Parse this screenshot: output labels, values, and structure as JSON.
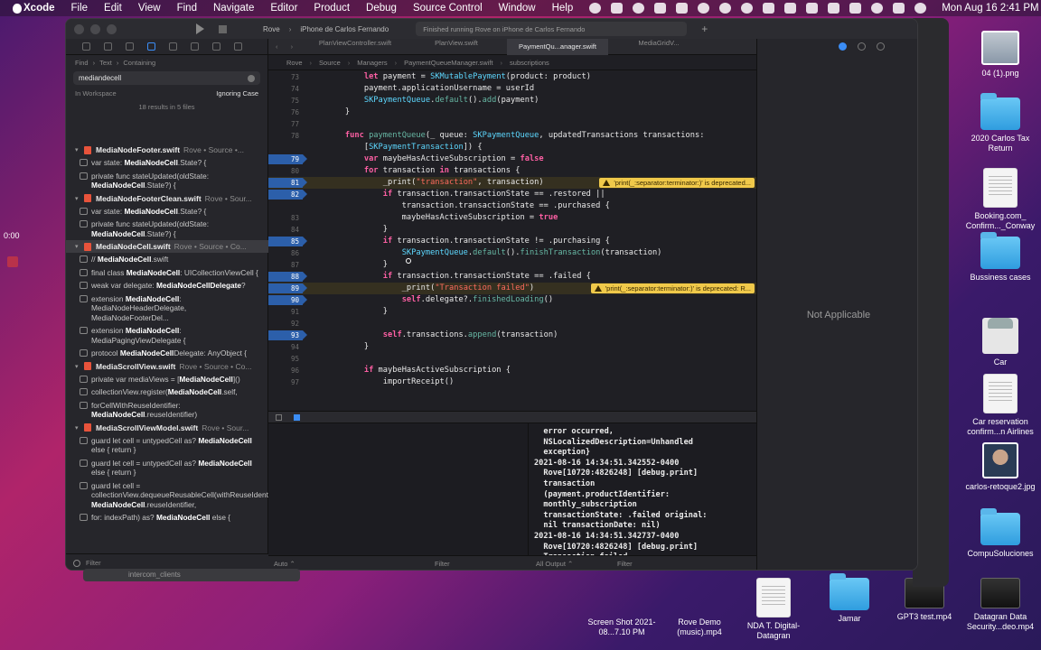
{
  "menubar": {
    "items": [
      "Xcode",
      "File",
      "Edit",
      "View",
      "Find",
      "Navigate",
      "Editor",
      "Product",
      "Debug",
      "Source Control",
      "Window",
      "Help"
    ],
    "clock": "Mon Aug 16  2:41 PM"
  },
  "desktop": {
    "icons": [
      {
        "label": "04 (1).png",
        "kind": "photo"
      },
      {
        "label": "2020 Carlos Tax Return",
        "kind": "folder"
      },
      {
        "label": "Booking.com_ Confirm..._Conway",
        "kind": "doc"
      },
      {
        "label": "Bussiness cases",
        "kind": "folder"
      },
      {
        "label": "Car",
        "kind": "car"
      },
      {
        "label": "Car reservation confirm...n Airlines",
        "kind": "doc"
      },
      {
        "label": "carlos-retoque2.jpg",
        "kind": "person"
      },
      {
        "label": "CompuSoluciones",
        "kind": "folder"
      },
      {
        "label": "Screen Shot 2021-08...7.10 PM",
        "kind": "none"
      },
      {
        "label": "Rove Demo (music).mp4",
        "kind": "none"
      },
      {
        "label": "NDA T. Digital-Datagran",
        "kind": "doc"
      },
      {
        "label": "Jamar",
        "kind": "folder"
      },
      {
        "label": "GPT3 test.mp4",
        "kind": "dark"
      },
      {
        "label": "Datagran Data Security...deo.mp4",
        "kind": "dark"
      }
    ]
  },
  "toolbar": {
    "scheme": "Rove",
    "destination": "iPhone de Carlos Fernando",
    "activity": "Finished running Rove on iPhone de Carlos Fernando"
  },
  "navigator": {
    "find_path": [
      "Find",
      "Text",
      "Containing"
    ],
    "search_query": "mediandecell",
    "scope": "In Workspace",
    "case_mode": "Ignoring Case",
    "results_count": "18 results in 5 files",
    "filter_placeholder": "Filter",
    "results": [
      {
        "type": "file",
        "name": "MediaNodeFooter.swift",
        "path": "Rove • Source •...",
        "selected": false
      },
      {
        "type": "match",
        "pre": "var state: ",
        "hit": "MediaNodeCell",
        "post": ".State? {"
      },
      {
        "type": "match",
        "pre": "private func stateUpdated(oldState: ",
        "hit": "MediaNodeCell",
        "post": ".State?) {"
      },
      {
        "type": "file",
        "name": "MediaNodeFooterClean.swift",
        "path": "Rove • Sour...",
        "selected": false
      },
      {
        "type": "match",
        "pre": "var state: ",
        "hit": "MediaNodeCell",
        "post": ".State? {"
      },
      {
        "type": "match",
        "pre": "private func stateUpdated(oldState: ",
        "hit": "MediaNodeCell",
        "post": ".State?) {"
      },
      {
        "type": "file",
        "name": "MediaNodeCell.swift",
        "path": "Rove • Source • Co...",
        "selected": true
      },
      {
        "type": "match",
        "pre": "// ",
        "hit": "MediaNodeCell",
        "post": ".swift"
      },
      {
        "type": "match",
        "pre": "final class ",
        "hit": "MediaNodeCell",
        "post": ": UICollectionViewCell {"
      },
      {
        "type": "match",
        "pre": "weak var delegate: ",
        "hit": "MediaNodeCellDelegate",
        "post": "?"
      },
      {
        "type": "match",
        "pre": "extension ",
        "hit": "MediaNodeCell",
        "post": ": MediaNodeHeaderDelegate, MediaNodeFooterDel..."
      },
      {
        "type": "match",
        "pre": "extension ",
        "hit": "MediaNodeCell",
        "post": ": MediaPagingViewDelegate {"
      },
      {
        "type": "match",
        "pre": "protocol ",
        "hit": "MediaNodeCell",
        "post": "Delegate: AnyObject {"
      },
      {
        "type": "file",
        "name": "MediaScrollView.swift",
        "path": "Rove • Source • Co...",
        "selected": false
      },
      {
        "type": "match",
        "pre": "private var mediaViews = [",
        "hit": "MediaNodeCell",
        "post": "]()"
      },
      {
        "type": "match",
        "pre": "collectionView.register(",
        "hit": "MediaNodeCell",
        "post": ".self,"
      },
      {
        "type": "match",
        "pre": "forCellWithReuseIdentifier: ",
        "hit": "MediaNodeCell",
        "post": ".reuseIdentifier)"
      },
      {
        "type": "file",
        "name": "MediaScrollViewModel.swift",
        "path": "Rove • Sour...",
        "selected": false
      },
      {
        "type": "match",
        "pre": "guard let cell = untypedCell as? ",
        "hit": "MediaNodeCell",
        "post": " else { return }"
      },
      {
        "type": "match",
        "pre": "guard let cell = untypedCell as? ",
        "hit": "MediaNodeCell",
        "post": " else { return }"
      },
      {
        "type": "match",
        "pre": "guard let cell = collectionView.dequeueReusableCell(withReuseIdentifier: ",
        "hit": "MediaNodeCell",
        "post": ".reuseIdentifier,"
      },
      {
        "type": "match",
        "pre": "for: indexPath) as? ",
        "hit": "MediaNodeCell",
        "post": " else {"
      }
    ]
  },
  "editor": {
    "tabs": [
      "PlanViewController.swift",
      "PlanView.swift",
      "PaymentQu...anager.swift",
      "MediaGridV..."
    ],
    "active_tab": 2,
    "jumpbar": [
      "Rove",
      "Source",
      "Managers",
      "PaymentQueueManager.swift",
      "subscriptions"
    ],
    "lines": [
      {
        "n": "73",
        "bp": false,
        "html": "        <span class=\"kw\">let</span> payment = <span class=\"typ\">SKMutablePayment</span>(product: product)"
      },
      {
        "n": "74",
        "bp": false,
        "html": "        payment.applicationUsername = userId"
      },
      {
        "n": "75",
        "bp": false,
        "html": "        <span class=\"typ\">SKPaymentQueue</span>.<span class=\"fn\">default</span>().<span class=\"fn\">add</span>(payment)"
      },
      {
        "n": "76",
        "bp": false,
        "html": "    }"
      },
      {
        "n": "77",
        "bp": false,
        "html": ""
      },
      {
        "n": "78",
        "bp": false,
        "html": "    <span class=\"kw\">func</span> <span class=\"fn\">paymentQueue</span>(_ queue: <span class=\"typ\">SKPaymentQueue</span>, updatedTransactions transactions:"
      },
      {
        "n": "",
        "bp": false,
        "html": "        [<span class=\"typ\">SKPaymentTransaction</span>]) {"
      },
      {
        "n": "79",
        "bp": true,
        "html": "        <span class=\"kw\">var</span> maybeHasActiveSubscription = <span class=\"kw\">false</span>"
      },
      {
        "n": "80",
        "bp": false,
        "html": "        <span class=\"kw\">for</span> transaction <span class=\"kw\">in</span> transactions {"
      },
      {
        "n": "81",
        "bp": true,
        "warn": "'print(_:separator:terminator:)' is deprecated...",
        "html": "            _print(<span class=\"str\">\"transaction\"</span>, transaction)"
      },
      {
        "n": "82",
        "bp": true,
        "html": "            <span class=\"kw\">if</span> transaction.transactionState == .restored ||"
      },
      {
        "n": "",
        "bp": false,
        "html": "                transaction.transactionState == .purchased {"
      },
      {
        "n": "83",
        "bp": false,
        "html": "                maybeHasActiveSubscription = <span class=\"kw\">true</span>"
      },
      {
        "n": "84",
        "bp": false,
        "html": "            }"
      },
      {
        "n": "85",
        "bp": true,
        "html": "            <span class=\"kw\">if</span> transaction.transactionState != .purchasing {"
      },
      {
        "n": "86",
        "bp": false,
        "html": "                <span class=\"typ\">SKPaymentQueue</span>.<span class=\"fn\">default</span>().<span class=\"fn\">finishTransaction</span>(transaction)"
      },
      {
        "n": "87",
        "bp": false,
        "html": "            }"
      },
      {
        "n": "88",
        "bp": true,
        "html": "            <span class=\"kw\">if</span> transaction.transactionState == .failed {"
      },
      {
        "n": "89",
        "bp": true,
        "warn": "'print(_:separator:terminator:)' is deprecated: R...",
        "html": "                _print(<span class=\"str\">\"Transaction failed\"</span>)"
      },
      {
        "n": "90",
        "bp": true,
        "html": "                <span class=\"kw\">self</span>.delegate?.<span class=\"fn\">finishedLoading</span>()"
      },
      {
        "n": "91",
        "bp": false,
        "html": "            }"
      },
      {
        "n": "92",
        "bp": false,
        "html": ""
      },
      {
        "n": "93",
        "bp": true,
        "html": "            <span class=\"kw\">self</span>.transactions.<span class=\"fn\">append</span>(transaction)"
      },
      {
        "n": "94",
        "bp": false,
        "html": "        }"
      },
      {
        "n": "95",
        "bp": false,
        "html": ""
      },
      {
        "n": "96",
        "bp": false,
        "html": "        <span class=\"kw\">if</span> maybeHasActiveSubscription {"
      },
      {
        "n": "97",
        "bp": false,
        "html": "            importReceipt()"
      }
    ]
  },
  "console": {
    "text": "  error occurred,\n  NSLocalizedDescription=Unhandled\n  exception}\n2021-08-16 14:34:51.342552-0400\n  Rove[10720:4826248] [debug.print]\n  transaction\n  (payment.productIdentifier:\n  monthly_subscription\n  transactionState: .failed original:\n  nil transactionDate: nil)\n2021-08-16 14:34:51.342737-0400\n  Rove[10720:4826248] [debug.print]\n  Transaction failed"
  },
  "bottom": {
    "variables_scope": "Auto ⌃",
    "variables_filter": "Filter",
    "console_scope": "All Output ⌃",
    "console_filter": "Filter"
  },
  "inspector": {
    "message": "Not Applicable"
  },
  "overlay": {
    "timer": "0:00",
    "under_label": "intercom_clients"
  }
}
